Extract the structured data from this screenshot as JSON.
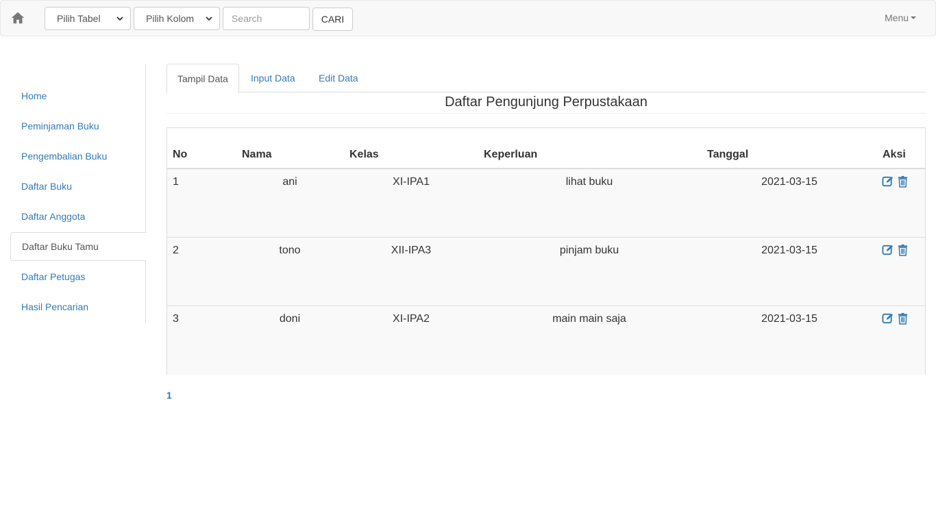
{
  "navbar": {
    "select_table": "Pilih Tabel",
    "select_column": "Pilih Kolom",
    "search_placeholder": "Search",
    "search_button": "CARI",
    "menu": "Menu"
  },
  "sidebar": {
    "items": [
      {
        "label": "Home",
        "active": false
      },
      {
        "label": "Peminjaman Buku",
        "active": false
      },
      {
        "label": "Pengembalian Buku",
        "active": false
      },
      {
        "label": "Daftar Buku",
        "active": false
      },
      {
        "label": "Daftar Anggota",
        "active": false
      },
      {
        "label": "Daftar Buku Tamu",
        "active": true
      },
      {
        "label": "Daftar Petugas",
        "active": false
      },
      {
        "label": "Hasil Pencarian",
        "active": false
      }
    ]
  },
  "tabs": [
    {
      "label": "Tampil Data",
      "active": true
    },
    {
      "label": "Input Data",
      "active": false
    },
    {
      "label": "Edit Data",
      "active": false
    }
  ],
  "page_title": "Daftar Pengunjung Perpustakaan",
  "table": {
    "headers": [
      "No",
      "Nama",
      "Kelas",
      "Keperluan",
      "Tanggal",
      "Aksi"
    ],
    "rows": [
      {
        "no": "1",
        "nama": "ani",
        "kelas": "XI-IPA1",
        "keperluan": "lihat buku",
        "tanggal": "2021-03-15"
      },
      {
        "no": "2",
        "nama": "tono",
        "kelas": "XII-IPA3",
        "keperluan": "pinjam buku",
        "tanggal": "2021-03-15"
      },
      {
        "no": "3",
        "nama": "doni",
        "kelas": "XI-IPA2",
        "keperluan": "main main saja",
        "tanggal": "2021-03-15"
      }
    ]
  },
  "pagination": {
    "current_page": "1"
  },
  "icons": {
    "home": "home-icon",
    "edit": "edit-icon",
    "delete": "trash-icon"
  },
  "colors": {
    "link": "#337ab7",
    "navbar_bg": "#f8f8f8",
    "row_bg": "#f9f9f9"
  }
}
